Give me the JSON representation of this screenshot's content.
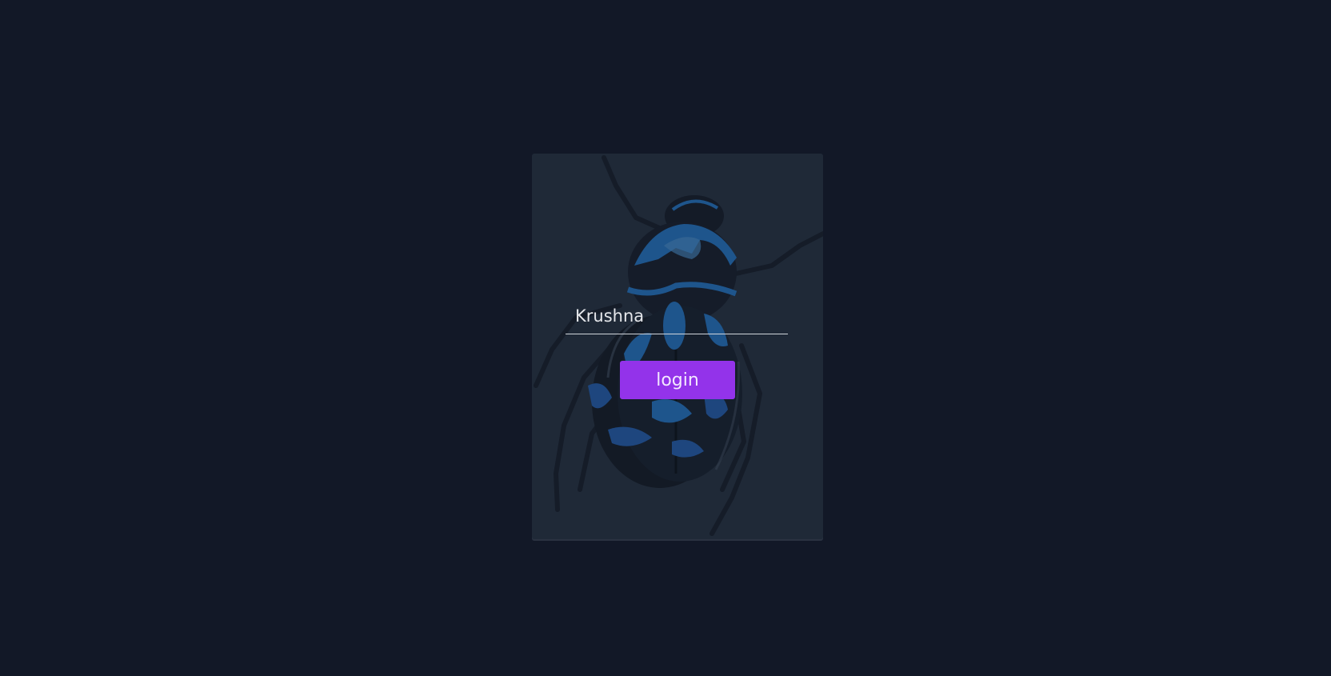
{
  "login_form": {
    "username_value": "Krushna",
    "username_placeholder": "",
    "login_label": "login"
  },
  "background_illustration": "beetle",
  "colors": {
    "page_background": "#121827",
    "card_background": "#1f2937",
    "button_accent": "#9333ea",
    "beetle_blue": "#1e5a96"
  }
}
